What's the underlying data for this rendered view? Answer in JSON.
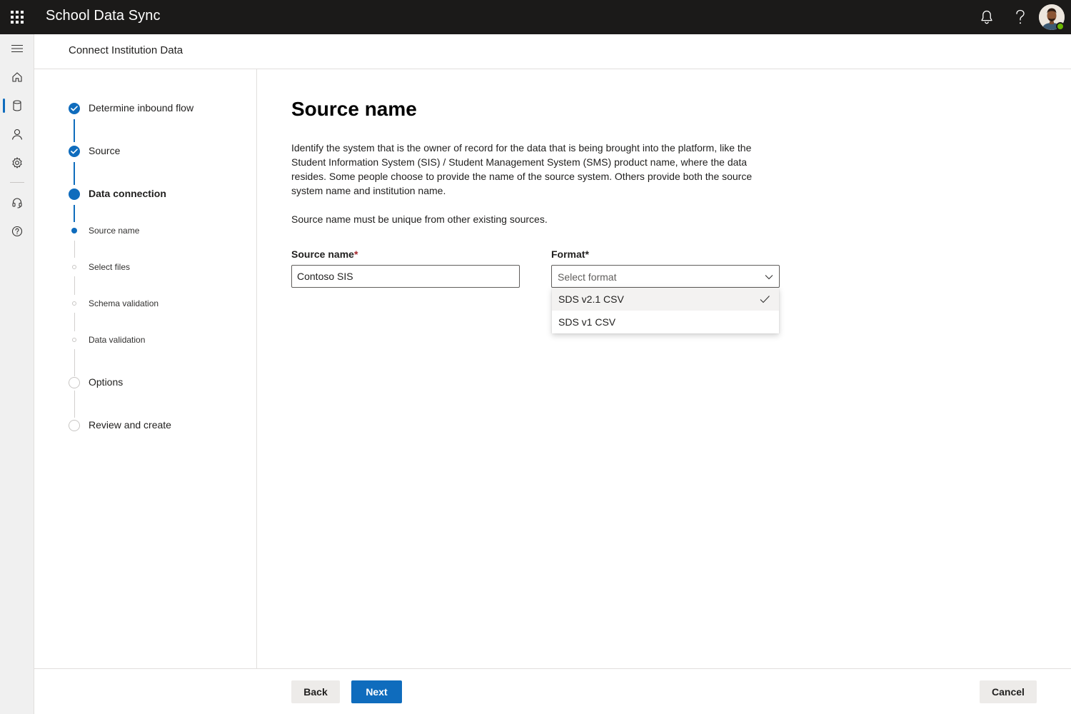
{
  "app": {
    "title": "School Data Sync",
    "icons": [
      "waffle-icon",
      "bell-icon",
      "help-icon",
      "avatar"
    ],
    "presence_color": "#6bb700"
  },
  "rail": {
    "items": [
      "menu-icon",
      "home-icon",
      "database-icon",
      "person-icon",
      "settings-icon",
      "headset-icon",
      "help-circle-icon"
    ],
    "active": "database-icon"
  },
  "header": {
    "title": "Connect Institution Data"
  },
  "steps": [
    {
      "label": "Determine inbound flow",
      "state": "done"
    },
    {
      "label": "Source",
      "state": "done"
    },
    {
      "label": "Data connection",
      "state": "current"
    },
    {
      "label": "Source name",
      "state": "current-sub"
    },
    {
      "label": "Select files",
      "state": "pending-sub"
    },
    {
      "label": "Schema validation",
      "state": "pending-sub"
    },
    {
      "label": "Data validation",
      "state": "pending-sub"
    },
    {
      "label": "Options",
      "state": "pending"
    },
    {
      "label": "Review and create",
      "state": "pending"
    }
  ],
  "main": {
    "heading": "Source name",
    "description": "Identify the system that is the owner of record for the data that is being brought into the platform, like the Student Information System (SIS) / Student Management System (SMS) product name, where the data resides. Some people choose to provide the name of the source system. Others provide both the source system name and institution name.",
    "note": "Source name must be unique from other existing sources.",
    "source_name": {
      "label": "Source name",
      "required_mark": "*",
      "value": "Contoso SIS"
    },
    "format": {
      "label": "Format",
      "required_mark": "*",
      "placeholder": "Select format",
      "options": [
        "SDS v2.1 CSV",
        "SDS v1 CSV"
      ],
      "checked_option": "SDS v2.1 CSV"
    }
  },
  "footer": {
    "back": "Back",
    "next": "Next",
    "cancel": "Cancel"
  },
  "colors": {
    "accent": "#0f6cbd",
    "topbar": "#1b1a19",
    "required": "#a4262c"
  }
}
